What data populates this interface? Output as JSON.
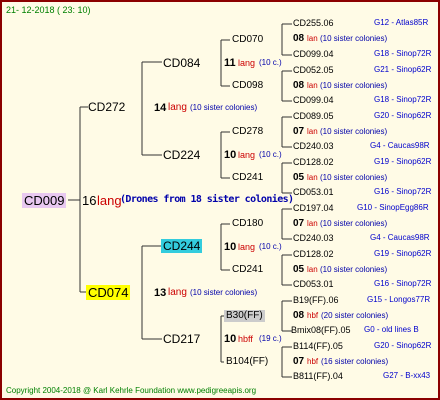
{
  "date": "21- 12-2018 ( 23: 10)",
  "copyright": "Copyright 2004-2018 @ Karl Kehrle Foundation    www.pedigreeapis.org",
  "colors": {
    "border": "#8b0000",
    "background": "#fffbe6",
    "lines": "#333333",
    "queen_highlight": "#e8c8f0",
    "cd244_highlight": "#33ccdd",
    "cd074_highlight": "#ffff00",
    "b30_highlight": "#cccccc",
    "origin_text": "#0000cc",
    "year_text": "#008000",
    "lang_text": "#cc0000"
  },
  "root": {
    "name": "CD009",
    "num": "16",
    "type": "lang",
    "note": "(Drones from 18 sister colonies)"
  },
  "l1": [
    {
      "name": "CD272",
      "num": "14",
      "type": "lang",
      "note": "(10 sister colonies)"
    },
    {
      "name": "CD074",
      "num": "13",
      "type": "lang",
      "note": "(10 sister colonies)"
    }
  ],
  "l2": [
    {
      "name": "CD084",
      "num": "11",
      "type": "lang",
      "note": "(10 c.)"
    },
    {
      "name": "CD224",
      "num": "10",
      "type": "lang",
      "note": "(10 c.)"
    },
    {
      "name": "CD244",
      "num": "10",
      "type": "lang",
      "note": "(10 c.)"
    },
    {
      "name": "CD217",
      "num": "10",
      "type": "hbff",
      "note": "(19 c.)"
    }
  ],
  "l3": [
    "CD070",
    "CD098",
    "CD278",
    "CD241",
    "CD180",
    "CD241",
    "B30(FF)",
    "B104(FF)"
  ],
  "l4": [
    {
      "name": "CD255.06",
      "origin": "G12 - Atlas85R"
    },
    {
      "num": "08",
      "type": "lan",
      "note": "(10 sister colonies)"
    },
    {
      "name": "CD099.04",
      "origin": "G18 - Sinop72R"
    },
    {
      "name": "CD052.05",
      "origin": "G21 - Sinop62R"
    },
    {
      "num": "08",
      "type": "lan",
      "note": "(10 sister colonies)"
    },
    {
      "name": "CD099.04",
      "origin": "G18 - Sinop72R"
    },
    {
      "name": "CD089.05",
      "origin": "G20 - Sinop62R"
    },
    {
      "num": "07",
      "type": "lan",
      "note": "(10 sister colonies)"
    },
    {
      "name": "CD240.03",
      "origin": "G4 - Caucas98R"
    },
    {
      "name": "CD128.02",
      "origin": "G19 - Sinop62R"
    },
    {
      "num": "05",
      "type": "lan",
      "note": "(10 sister colonies)"
    },
    {
      "name": "CD053.01",
      "origin": "G16 - Sinop72R"
    },
    {
      "name": "CD197.04",
      "origin": "G10 - SinopEgg86R"
    },
    {
      "num": "07",
      "type": "lan",
      "note": "(10 sister colonies)"
    },
    {
      "name": "CD240.03",
      "origin": "G4 - Caucas98R"
    },
    {
      "name": "CD128.02",
      "origin": "G19 - Sinop62R"
    },
    {
      "num": "05",
      "type": "lan",
      "note": "(10 sister colonies)"
    },
    {
      "name": "CD053.01",
      "origin": "G16 - Sinop72R"
    },
    {
      "name": "B19(FF).06",
      "origin": "G15 - Longos77R"
    },
    {
      "num": "08",
      "type": "hbf",
      "note": "(20 sister colonies)"
    },
    {
      "name": "Bmix08(FF).05",
      "origin": "G0 - old lines B"
    },
    {
      "name": "B114(FF).05",
      "origin": "G20 - Sinop62R"
    },
    {
      "num": "07",
      "type": "hbf",
      "note": "(16 sister colonies)"
    },
    {
      "name": "B811(FF).04",
      "origin": "G27 - B-xx43"
    }
  ]
}
